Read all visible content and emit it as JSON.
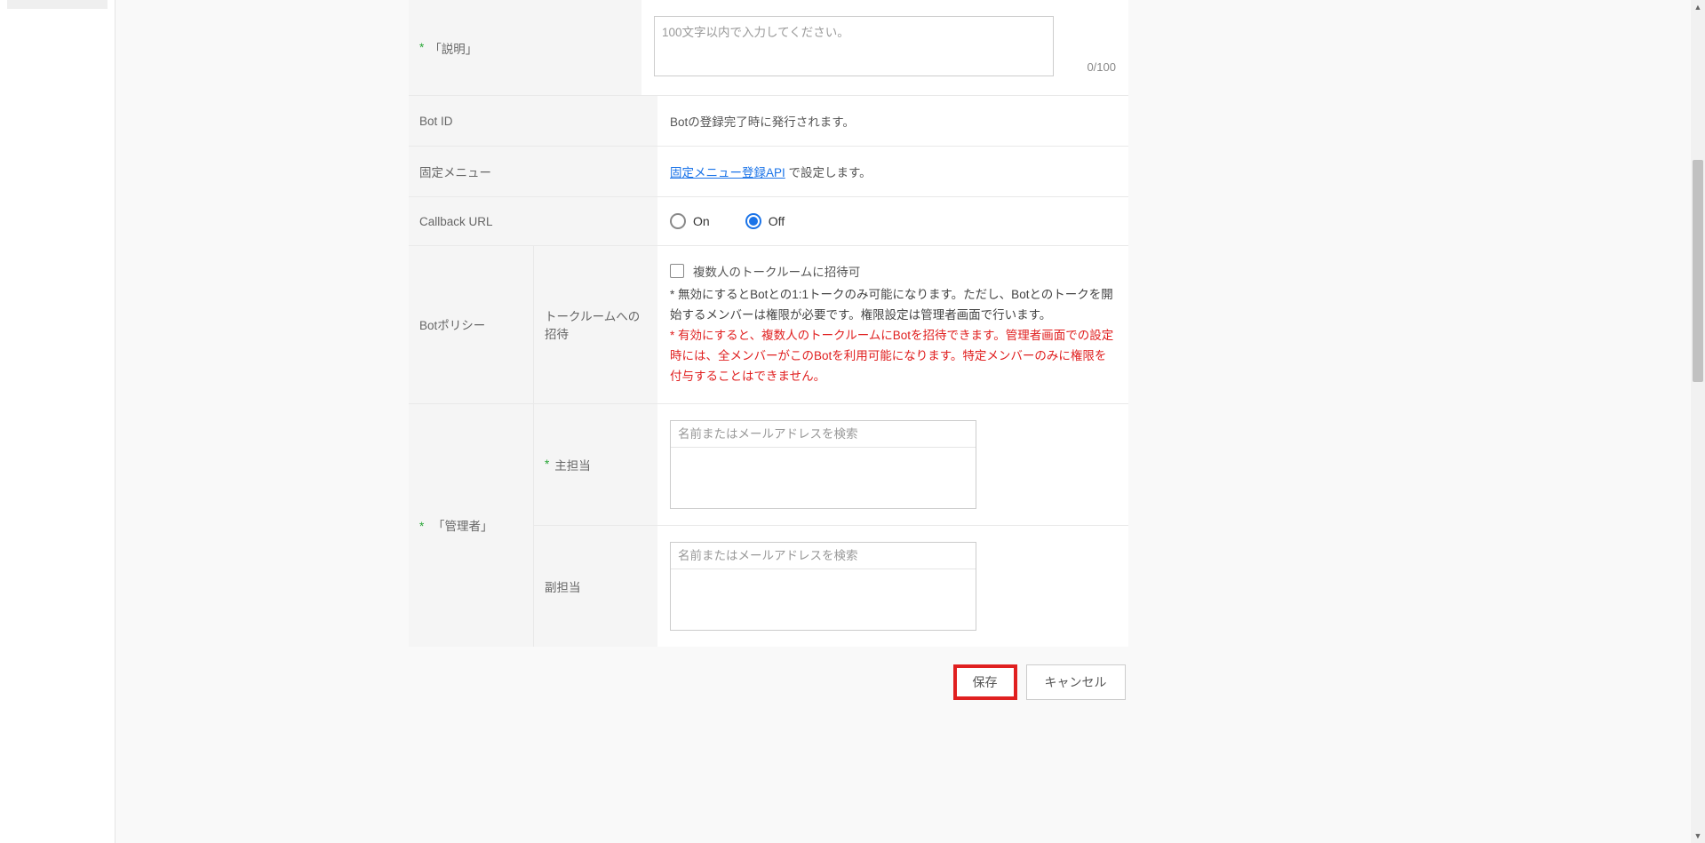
{
  "form": {
    "description": {
      "label": "「説明」",
      "placeholder": "100文字以内で入力してください。",
      "value": "",
      "counter": "0/100"
    },
    "bot_id": {
      "label": "Bot ID",
      "value": "Botの登録完了時に発行されます。"
    },
    "fixed_menu": {
      "label": "固定メニュー",
      "link_text": "固定メニュー登録API",
      "suffix": " で設定します。"
    },
    "callback": {
      "label": "Callback URL",
      "on": "On",
      "off": "Off",
      "selected": "off"
    },
    "policy": {
      "label": "Botポリシー",
      "sub_label": "トークルームへの招待",
      "checkbox_label": "複数人のトークルームに招待可",
      "note_black": "* 無効にするとBotとの1:1トークのみ可能になります。ただし、Botとのトークを開始するメンバーは権限が必要です。権限設定は管理者画面で行います。",
      "note_red": "* 有効にすると、複数人のトークルームにBotを招待できます。管理者画面での設定時には、全メンバーがこのBotを利用可能になります。特定メンバーのみに権限を付与することはできません。"
    },
    "admin": {
      "label": "「管理者」",
      "primary_label": "主担当",
      "secondary_label": "副担当",
      "search_placeholder": "名前またはメールアドレスを検索"
    }
  },
  "buttons": {
    "save": "保存",
    "cancel": "キャンセル"
  }
}
